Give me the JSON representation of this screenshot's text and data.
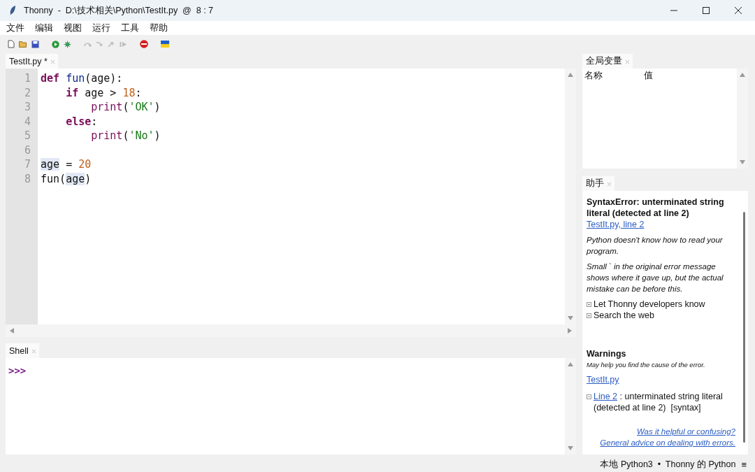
{
  "window": {
    "title": "Thonny  -  D:\\技术相关\\Python\\TestIt.py  @  8 : 7"
  },
  "menu": [
    "文件",
    "编辑",
    "视图",
    "运行",
    "工具",
    "帮助"
  ],
  "toolbar": [
    {
      "kind": "new",
      "disabled": false
    },
    {
      "kind": "open",
      "disabled": false
    },
    {
      "kind": "save",
      "disabled": false
    },
    {
      "kind": "run",
      "disabled": false
    },
    {
      "kind": "debug",
      "disabled": false
    },
    {
      "kind": "step-over",
      "disabled": true
    },
    {
      "kind": "step-into",
      "disabled": true
    },
    {
      "kind": "step-out",
      "disabled": true
    },
    {
      "kind": "resume",
      "disabled": true
    },
    {
      "kind": "stop",
      "disabled": false
    },
    {
      "kind": "flag",
      "disabled": false
    }
  ],
  "editor": {
    "tab": {
      "label": "TestIt.py *",
      "selected": true
    },
    "lines": [
      {
        "number": "1",
        "tokens": [
          {
            "text": "def",
            "kind": "kw"
          },
          {
            "text": " fun",
            "kind": "fn"
          },
          {
            "text": "(age):",
            "kind": "plain"
          }
        ]
      },
      {
        "number": "2",
        "tokens": [
          {
            "text": "    if",
            "kind": "kw"
          },
          {
            "text": " age > ",
            "kind": "plain"
          },
          {
            "text": "18",
            "kind": "num"
          },
          {
            "text": ":",
            "kind": "plain"
          }
        ]
      },
      {
        "number": "3",
        "tokens": [
          {
            "text": "        print",
            "kind": "builtin"
          },
          {
            "text": "(",
            "kind": "plain"
          },
          {
            "text": "'OK'",
            "kind": "str"
          },
          {
            "text": ")",
            "kind": "plain"
          }
        ]
      },
      {
        "number": "4",
        "tokens": [
          {
            "text": "    else",
            "kind": "kw"
          },
          {
            "text": ":",
            "kind": "plain"
          }
        ]
      },
      {
        "number": "5",
        "tokens": [
          {
            "text": "        print",
            "kind": "builtin"
          },
          {
            "text": "(",
            "kind": "plain"
          },
          {
            "text": "'No'",
            "kind": "str"
          },
          {
            "text": ")",
            "kind": "plain"
          }
        ]
      },
      {
        "number": "6"
      },
      {
        "number": "7",
        "tokens": [
          {
            "text": "age",
            "kind": "hl"
          },
          {
            "text": " = ",
            "kind": "plain"
          },
          {
            "text": "20",
            "kind": "num"
          }
        ]
      },
      {
        "number": "8",
        "tokens": [
          {
            "text": "fun(",
            "kind": "plain"
          },
          {
            "text": "age",
            "kind": "hl"
          },
          {
            "text": ")",
            "kind": "plain"
          }
        ]
      }
    ]
  },
  "shell": {
    "tab": {
      "label": "Shell",
      "selected": true
    },
    "prompt": ">>>"
  },
  "variables": {
    "tab": {
      "label": "全局变量",
      "selected": true
    },
    "columns": [
      "名称",
      "值"
    ]
  },
  "assistant": {
    "tab": {
      "label": "助手",
      "selected": true
    },
    "blocks": [
      {
        "kind": "error",
        "text": "SyntaxError: unterminated string literal (detected at line 2)"
      },
      {
        "kind": "link",
        "text": "TestIt.py, line 2"
      },
      {
        "kind": "note",
        "text": "Python doesn't know how to read your program."
      },
      {
        "kind": "note",
        "text": "Small ` in the original error message shows where it gave up, but the actual mistake can be before this."
      },
      {
        "kind": "expander",
        "text": "Let Thonny developers know"
      },
      {
        "kind": "expander",
        "text": "Search the web"
      },
      {
        "kind": "heading",
        "text": "Warnings"
      },
      {
        "kind": "hint",
        "text": "May help you find the cause of the error."
      },
      {
        "kind": "link",
        "text": "TestIt.py"
      },
      {
        "kind": "warning",
        "link": "Line 2",
        "text": ": unterminated string literal (detected at line 2)  [syntax]"
      },
      {
        "kind": "footer",
        "text": "Was it helpful or confusing?"
      },
      {
        "kind": "footer",
        "text": "General advice on dealing with errors."
      }
    ]
  },
  "status_bar": {
    "interpreter": "本地 Python3  •  Thonny 的 Python",
    "menu": "≡"
  }
}
